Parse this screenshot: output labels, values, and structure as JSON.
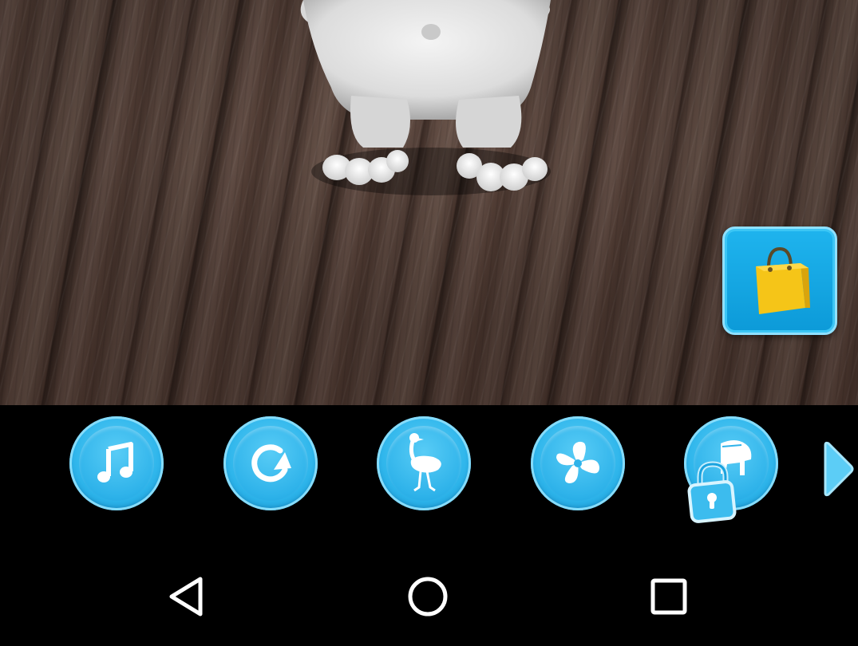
{
  "colors": {
    "accent_blue": "#2fb3ea",
    "floor_brown": "#5d4840",
    "bag_yellow": "#f5c518",
    "toolbar_bg": "#000000"
  },
  "scene": {
    "character": "white-furry-creature-feet"
  },
  "shop": {
    "icon": "shopping-bag-icon"
  },
  "toolbar": {
    "buttons": [
      {
        "icon": "music-note-icon",
        "locked": false
      },
      {
        "icon": "redo-arrow-icon",
        "locked": false
      },
      {
        "icon": "ostrich-icon",
        "locked": false
      },
      {
        "icon": "fan-icon",
        "locked": false
      },
      {
        "icon": "piano-icon",
        "locked": true
      }
    ],
    "next_icon": "chevron-right-icon"
  },
  "navbar": {
    "buttons": [
      "back-icon",
      "home-icon",
      "recents-icon"
    ]
  }
}
